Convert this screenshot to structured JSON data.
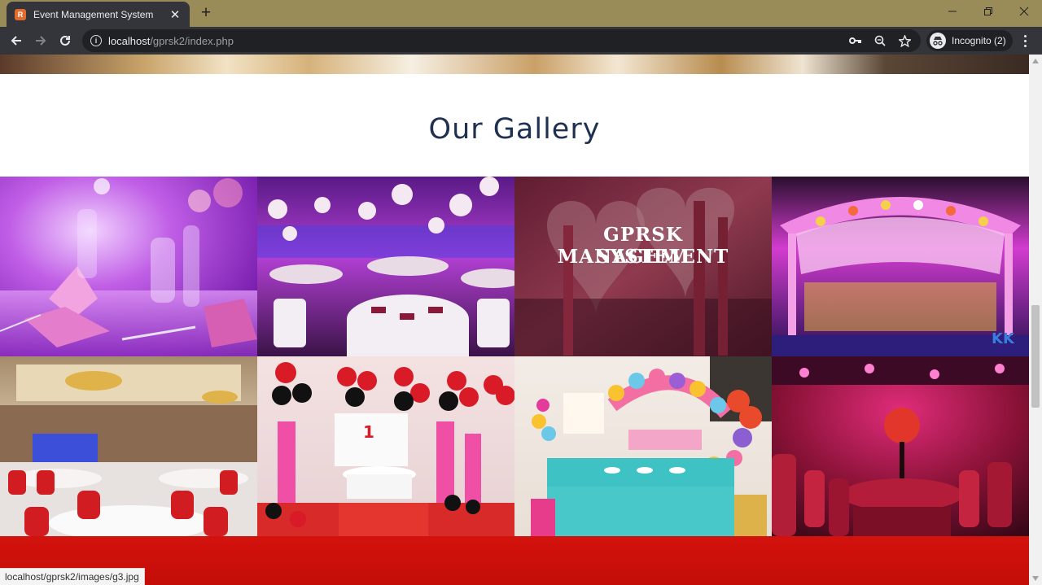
{
  "browser": {
    "tab": {
      "title": "Event Management System",
      "favicon_text": "R"
    },
    "url": {
      "host": "localhost",
      "path": "/gprsk2/index.php"
    },
    "incognito_label": "Incognito (2)",
    "status_url": "localhost/gprsk2/images/g3.jpg"
  },
  "page": {
    "gallery_heading": "Our Gallery",
    "gallery_images": [
      {
        "id": "g1",
        "caption": ""
      },
      {
        "id": "g2",
        "caption": ""
      },
      {
        "id": "g3",
        "caption_line1": "GPRSK MANAGEMENT",
        "caption_line2": "SYSTEM"
      },
      {
        "id": "g4",
        "caption": ""
      },
      {
        "id": "g5",
        "caption": ""
      },
      {
        "id": "g6",
        "caption": ""
      },
      {
        "id": "g7",
        "caption": ""
      },
      {
        "id": "g8",
        "caption": ""
      }
    ]
  },
  "colors": {
    "heading": "#1f3050",
    "footer_band": "#d3120c",
    "chrome_titlebar": "#9a8c58",
    "chrome_toolbar": "#34353a"
  },
  "icons": [
    "back-icon",
    "forward-icon",
    "reload-icon",
    "info-icon",
    "key-icon",
    "zoom-icon",
    "star-icon",
    "incognito-icon",
    "menu-icon",
    "minimize-icon",
    "restore-icon",
    "close-icon",
    "plus-icon"
  ]
}
